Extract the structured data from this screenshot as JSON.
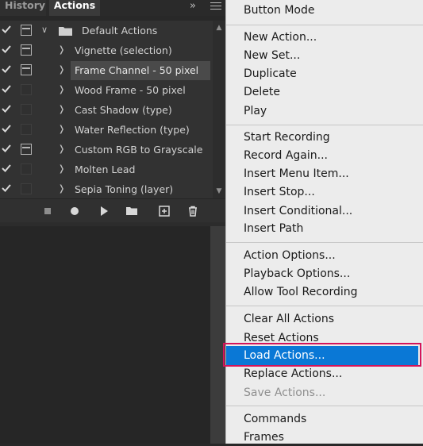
{
  "tabs": {
    "history": "History",
    "actions": "Actions"
  },
  "action_rows": [
    {
      "label": "Default Actions",
      "type": "set",
      "checked": true,
      "dialog": "on"
    },
    {
      "label": "Vignette (selection)",
      "type": "action",
      "checked": true,
      "dialog": "on"
    },
    {
      "label": "Frame Channel - 50 pixel",
      "type": "action",
      "checked": true,
      "dialog": "on",
      "selected": true
    },
    {
      "label": "Wood Frame - 50 pixel",
      "type": "action",
      "checked": true,
      "dialog": "off"
    },
    {
      "label": "Cast Shadow (type)",
      "type": "action",
      "checked": true,
      "dialog": "off"
    },
    {
      "label": "Water Reflection (type)",
      "type": "action",
      "checked": true,
      "dialog": "off"
    },
    {
      "label": "Custom RGB to Grayscale",
      "type": "action",
      "checked": true,
      "dialog": "on"
    },
    {
      "label": "Molten Lead",
      "type": "action",
      "checked": true,
      "dialog": "off"
    },
    {
      "label": "Sepia Toning (layer)",
      "type": "action",
      "checked": true,
      "dialog": "off"
    }
  ],
  "toolbar_icons": [
    "stop-icon",
    "record-icon",
    "play-icon",
    "folder-icon",
    "new-action-icon",
    "trash-icon"
  ],
  "menu": {
    "button_mode": "Button Mode",
    "new_action": "New Action...",
    "new_set": "New Set...",
    "duplicate": "Duplicate",
    "delete": "Delete",
    "play": "Play",
    "start_recording": "Start Recording",
    "record_again": "Record Again...",
    "insert_menu_item": "Insert Menu Item...",
    "insert_stop": "Insert Stop...",
    "insert_conditional": "Insert Conditional...",
    "insert_path": "Insert Path",
    "action_options": "Action Options...",
    "playback_options": "Playback Options...",
    "allow_tool_recording": "Allow Tool Recording",
    "clear_all_actions": "Clear All Actions",
    "reset_actions": "Reset Actions",
    "load_actions": "Load Actions...",
    "replace_actions": "Replace Actions...",
    "save_actions": "Save Actions...",
    "commands": "Commands",
    "frames": "Frames"
  },
  "colors": {
    "highlight": "#0a78d6",
    "outline": "#d4145a"
  }
}
